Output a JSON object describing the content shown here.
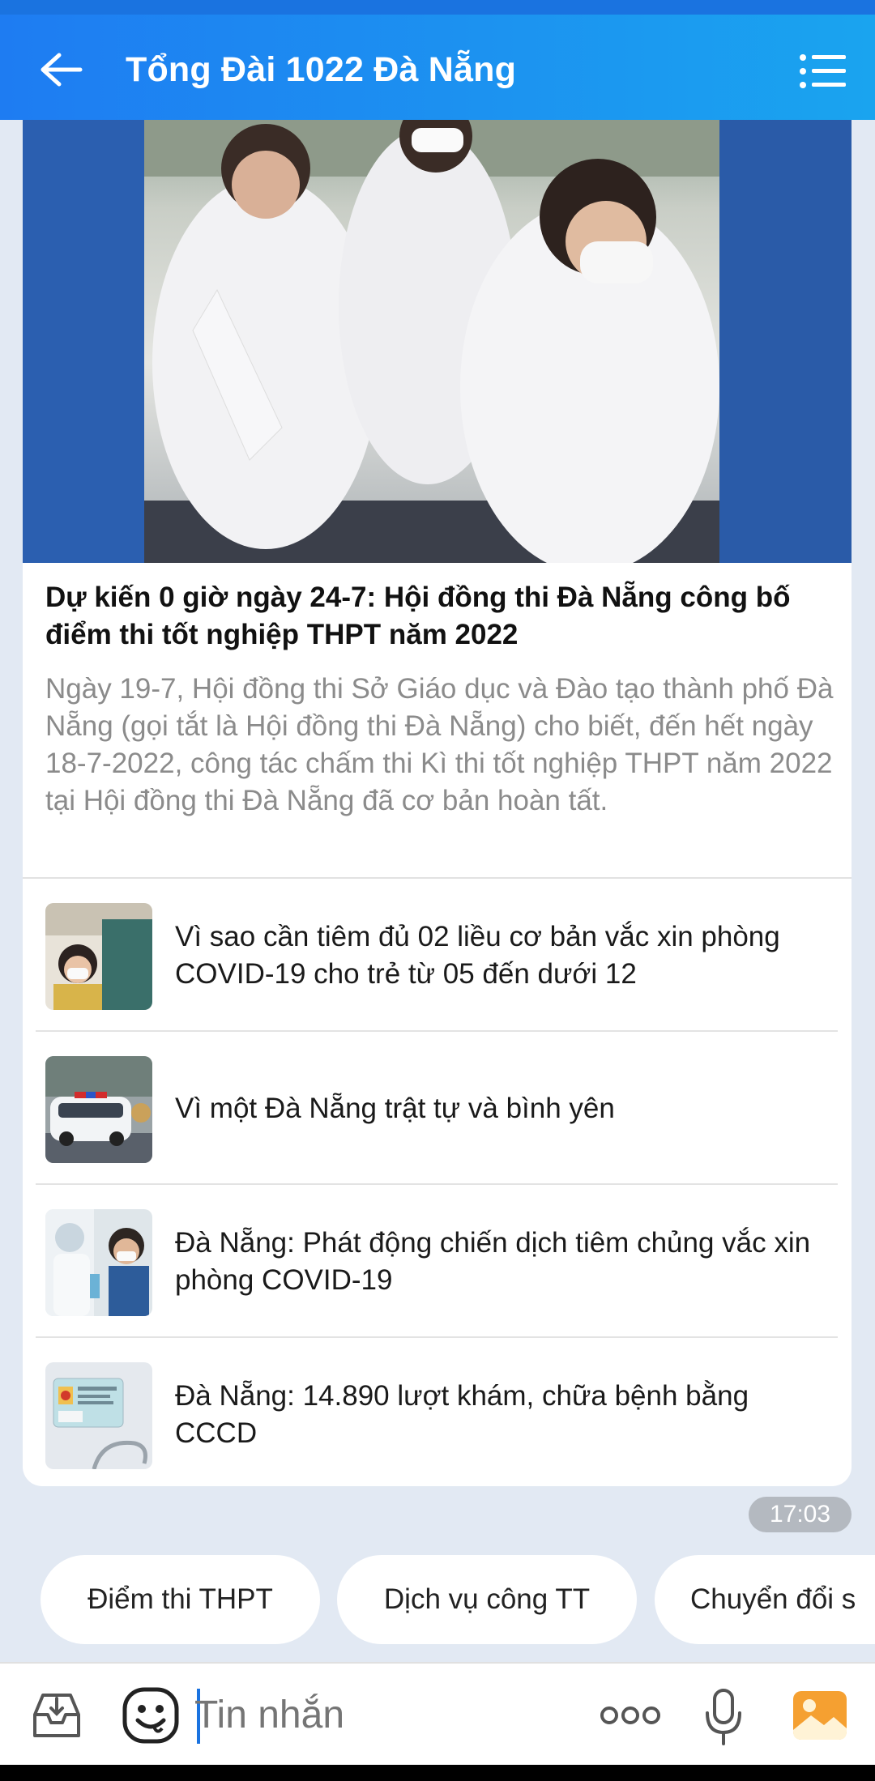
{
  "header": {
    "title": "Tổng Đài 1022 Đà Nẵng"
  },
  "featured": {
    "title": "Dự kiến 0 giờ ngày 24-7: Hội đồng thi Đà Nẵng công bố điểm thi tốt nghiệp THPT năm 2022",
    "description": "Ngày 19-7, Hội đồng thi Sở Giáo dục và Đào tạo thành phố Đà Nẵng (gọi tắt là Hội đồng thi Đà Nẵng) cho biết, đến hết ngày 18-7-2022, công tác chấm thi Kì thi tốt nghiệp THPT năm 2022 tại Hội đồng thi Đà Nẵng đã cơ bản hoàn tất."
  },
  "articles": [
    {
      "title": "Vì sao cần tiêm đủ 02 liều cơ bản vắc xin phòng COVID-19 cho trẻ từ 05 đến dưới 12"
    },
    {
      "title": "Vì một Đà Nẵng trật tự và bình yên"
    },
    {
      "title": "Đà Nẵng: Phát động chiến dịch tiêm chủng vắc xin phòng COVID-19"
    },
    {
      "title": "Đà Nẵng: 14.890 lượt khám, chữa bệnh bằng CCCD"
    }
  ],
  "message_time": "17:03",
  "quick_replies": [
    {
      "label": "Điểm thi THPT"
    },
    {
      "label": "Dịch vụ công TT"
    },
    {
      "label": "Chuyển đổi s"
    }
  ],
  "composer": {
    "placeholder": "Tin nhắn"
  },
  "colors": {
    "header_start": "#1e7cf2",
    "header_end": "#1aa4ef",
    "background": "#e2e9f3",
    "accent": "#1a73e0"
  }
}
